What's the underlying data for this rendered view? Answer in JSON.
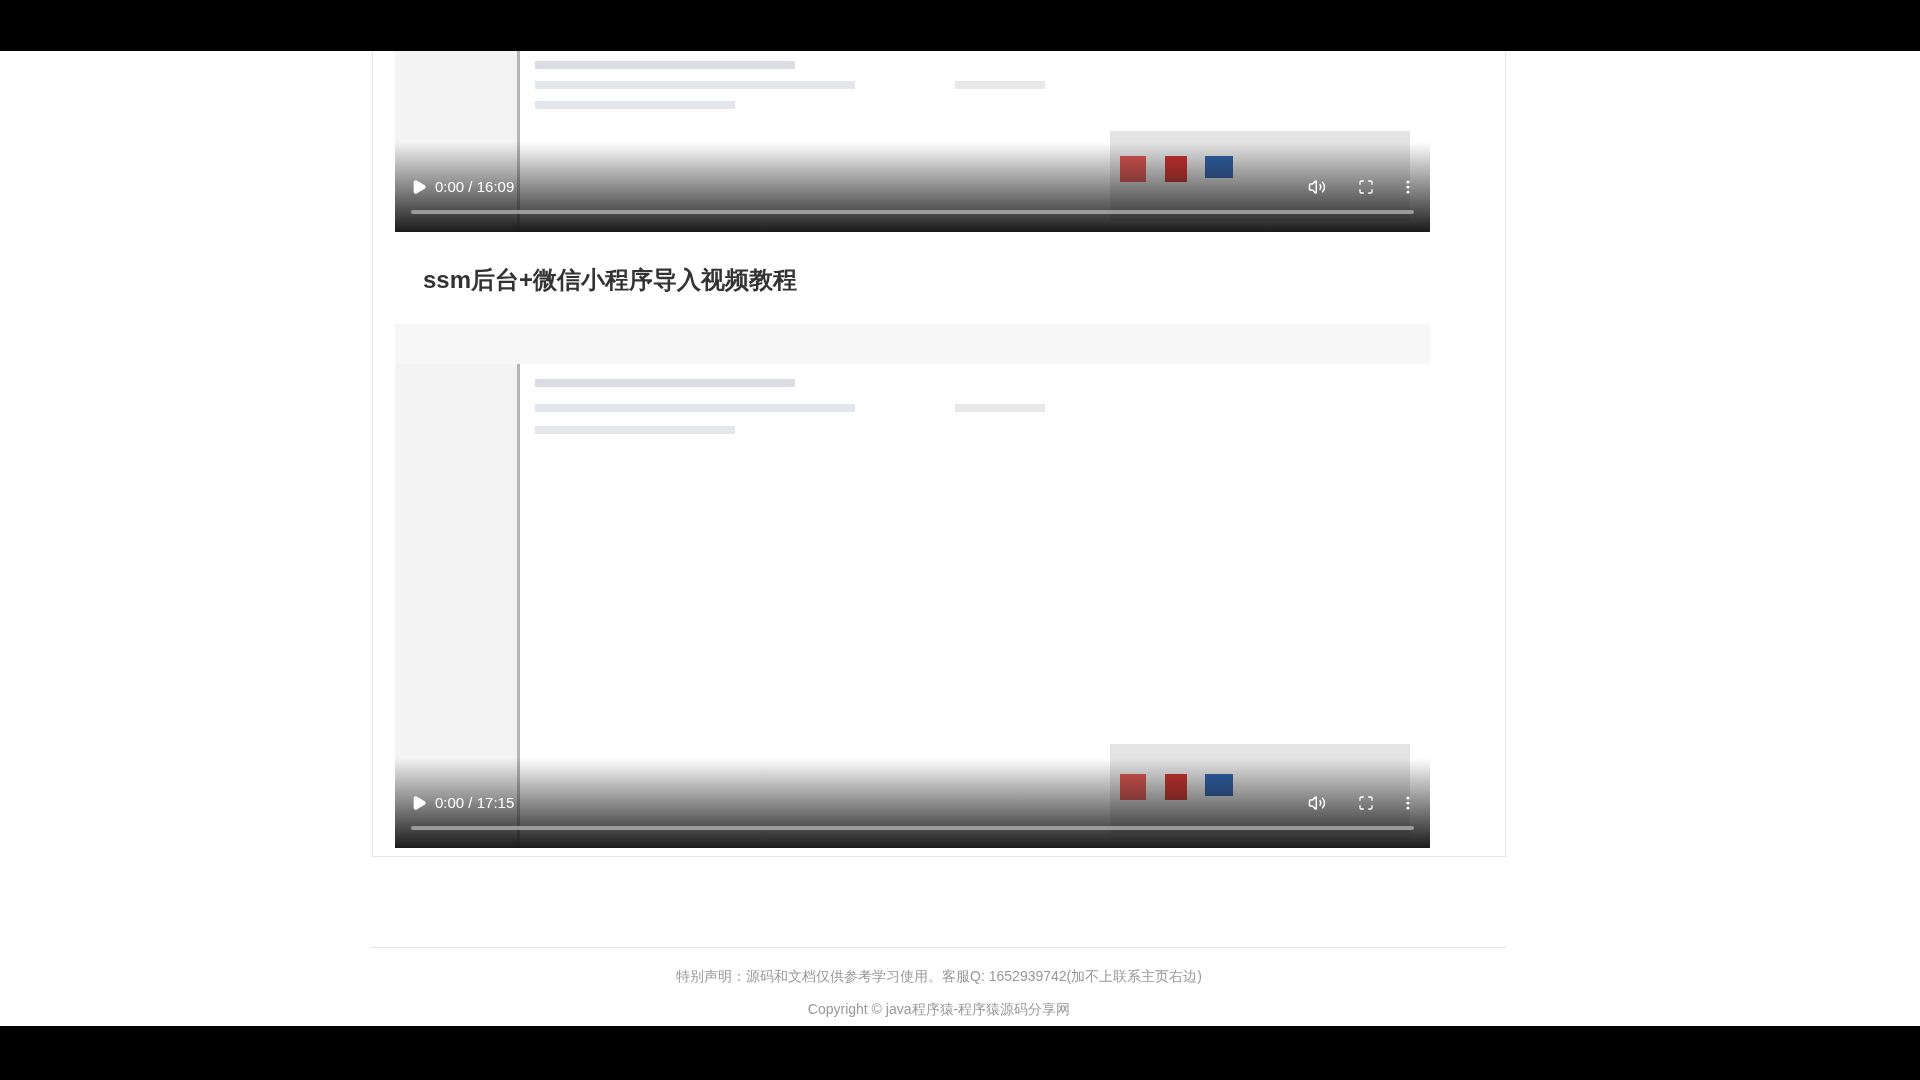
{
  "videos": [
    {
      "kind": "picture",
      "time": "0:00 / 16:09",
      "level": 0
    },
    {
      "kind": "picture",
      "time": "0:00 / 17:15",
      "level": 0
    }
  ],
  "section_title": "ssm后台+微信小程序导入视频教程",
  "footer": {
    "notice": "特别声明：源码和文档仅供参考学习使用。客服Q: 1652939742(加不上联系主页右边)",
    "copyright": "Copyright © java程序猿-程序猿源码分享网"
  }
}
